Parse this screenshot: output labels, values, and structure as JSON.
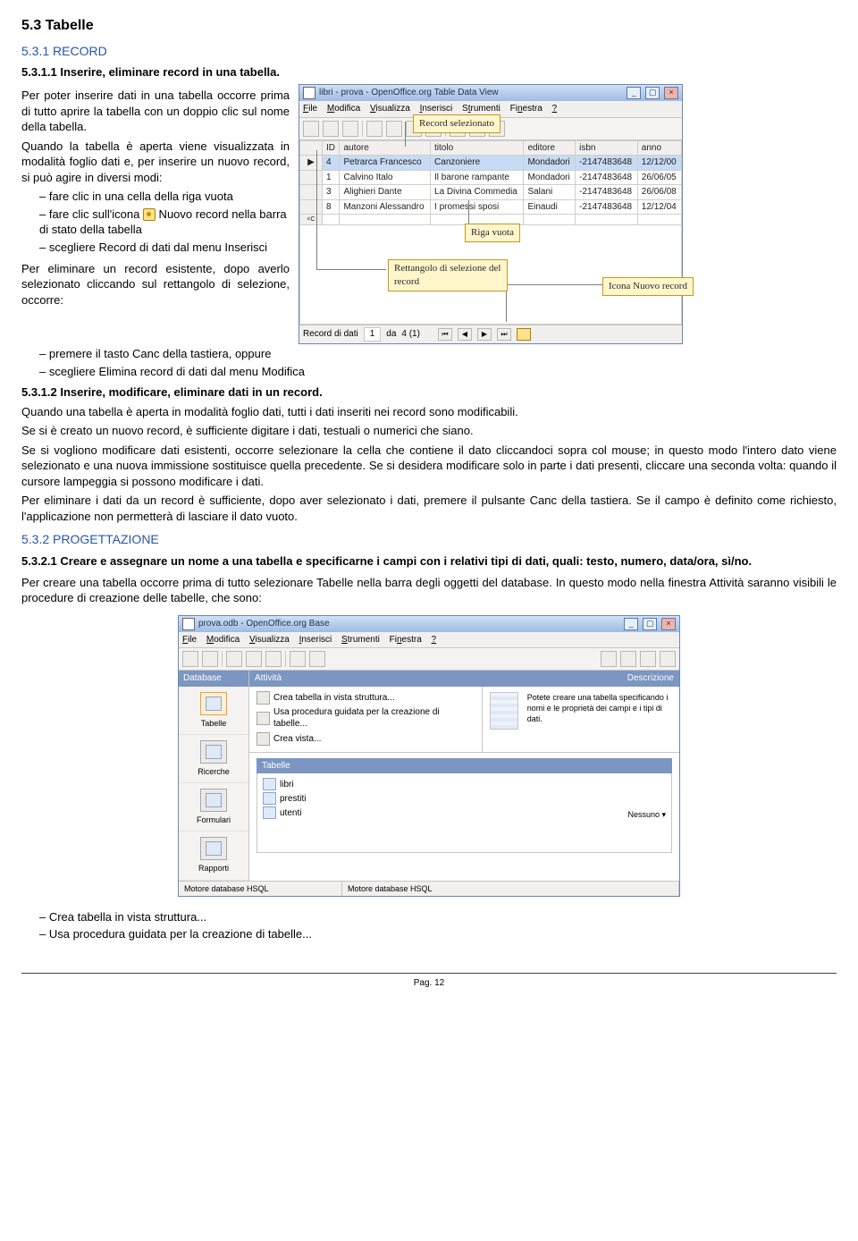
{
  "heading_1": "5.3 Tabelle",
  "heading_2": "5.3.1 RECORD",
  "heading_3": "5.3.1.1 Inserire, eliminare record in una tabella.",
  "p1": "Per poter inserire dati in una tabella occorre prima di tutto aprire la tabella con un doppio clic sul nome della tabella.",
  "p2": "Quando la tabella è aperta viene visualizzata in modalità foglio dati e, per inserire un nuovo record, si può agire in diversi modi:",
  "b1": "fare clic in una cella della riga vuota",
  "b2a": "fare clic sull'icona",
  "b2b": " Nuovo record nella barra di stato della tabella",
  "b3": "scegliere Record di dati dal menu Inserisci",
  "p3": "Per eliminare un record esistente, dopo averlo selezionato cliccando sul rettangolo di selezione, occorre:",
  "b4": "premere il tasto Canc della tastiera, oppure",
  "b5": "scegliere Elimina record di dati dal menu Modifica",
  "heading_4": "5.3.1.2 Inserire, modificare, eliminare dati in un record.",
  "p4": "Quando una tabella è aperta in modalità foglio dati, tutti i dati inseriti nei record sono modificabili.",
  "p5": "Se si è creato un nuovo record, è sufficiente digitare i dati, testuali o numerici che siano.",
  "p6": "Se si vogliono modificare dati esistenti, occorre selezionare la cella che contiene il dato cliccandoci sopra col mouse; in questo modo l'intero dato viene selezionato e una nuova immissione sostituisce quella precedente. Se si desidera modificare solo in parte i dati presenti, cliccare una seconda volta: quando il cursore lampeggia si possono modificare i dati.",
  "p7": "Per eliminare i dati da un record è sufficiente, dopo aver selezionato i dati, premere il pulsante Canc della tastiera. Se il campo è definito come richiesto, l'applicazione non permetterà di lasciare il dato vuoto.",
  "heading_5": "5.3.2 PROGETTAZIONE",
  "heading_6": "5.3.2.1 Creare e assegnare un nome a una tabella e specificarne i campi con i relativi tipi di dati, quali: testo, numero, data/ora, sì/no.",
  "p8": "Per creare una tabella occorre prima di tutto selezionare Tabelle nella barra degli oggetti del database. In questo modo nella finestra Attività saranno visibili le procedure di creazione delle tabelle, che sono:",
  "b6": "Crea tabella in vista struttura...",
  "b7": "Usa procedura guidata per la creazione di tabelle...",
  "page_footer": "Pag. 12",
  "callouts": {
    "rec_sel": "Record selezionato",
    "riga_vuota": "Riga vuota",
    "rett_sel": "Rettangolo di selezione del record",
    "icona_nuovo": "Icona Nuovo record"
  },
  "tdv": {
    "title": "libri - prova - OpenOffice.org Table Data View",
    "menu": [
      "File",
      "Modifica",
      "Visualizza",
      "Inserisci",
      "Strumenti",
      "Finestra",
      "?"
    ],
    "headers": [
      "ID",
      "autore",
      "titolo",
      "editore",
      "isbn",
      "anno"
    ],
    "rows": [
      [
        "4",
        "Petrarca Francesco",
        "Canzoniere",
        "Mondadori",
        "-2147483648",
        "12/12/00"
      ],
      [
        "1",
        "Calvino Italo",
        "Il barone rampante",
        "Mondadori",
        "-2147483648",
        "26/06/05"
      ],
      [
        "3",
        "Alighieri Dante",
        "La Divina Commedia",
        "Salani",
        "-2147483648",
        "26/06/08"
      ],
      [
        "8",
        "Manzoni Alessandro",
        "I promessi sposi",
        "Einaudi",
        "-2147483648",
        "12/12/04"
      ]
    ],
    "nav_label": "Record di dati",
    "nav_cur": "1",
    "nav_da": "da",
    "nav_tot": "4 (1)",
    "rowhdrs": [
      "▶",
      "",
      "",
      "",
      "<C"
    ]
  },
  "base": {
    "title": "prova.odb - OpenOffice.org Base",
    "menu": [
      "File",
      "Modifica",
      "Visualizza",
      "Inserisci",
      "Strumenti",
      "Finestra",
      "?"
    ],
    "side_hdr": "Database",
    "side_items": [
      "Tabelle",
      "Ricerche",
      "Formulari",
      "Rapporti"
    ],
    "activity_hdr": "Attività",
    "activities": [
      "Crea tabella in vista struttura...",
      "Usa procedura guidata per la creazione di tabelle...",
      "Crea vista..."
    ],
    "desc_hdr": "Descrizione",
    "desc_text": "Potete creare una tabella specificando i nomi e le proprietà dei campi e i tipi di dati.",
    "tables_hdr": "Tabelle",
    "tables": [
      "libri",
      "prestiti",
      "utenti"
    ],
    "nessuno": "Nessuno ▾",
    "status_l": "Motore database HSQL",
    "status_r": "Motore database HSQL"
  }
}
